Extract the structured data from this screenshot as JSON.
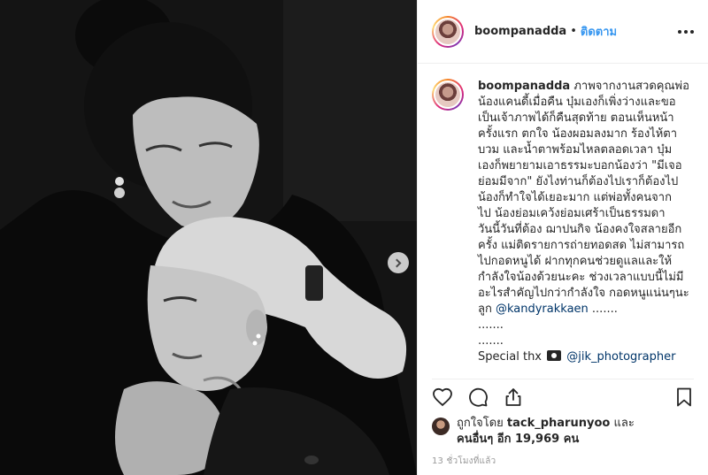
{
  "header": {
    "username": "boompanadda",
    "separator": "•",
    "follow_label": "ติดตาม",
    "more_icon": "ellipsis-icon"
  },
  "caption": {
    "username": "boompanadda",
    "lines": [
      "ภาพจากงานสวดคุณพ่อ",
      "น้องแคนดี้เมื่อคืน บุ๋มเองก็เพิ่งว่างและขอ",
      "เป็นเจ้าภาพได้ก็คืนสุดท้าย ตอนเห็นหน้า",
      "ครั้งแรก ตกใจ น้องผอมลงมาก ร้องไห้ตา",
      "บวม และน้ำตาพร้อมไหลตลอดเวลา บุ๋ม",
      "เองก็พยายามเอาธรรมะบอกน้องว่า \"มีเจอ",
      "ย่อมมีจาก\" ยังไงท่านก็ต้องไปเราก็ต้องไป",
      "น้องก็ทำใจได้เยอะมาก แต่พ่อทั้งคนจาก",
      "ไป น้องย่อมเคว้งย่อมเศร้าเป็นธรรมดา",
      "วันนี้วันที่ต้อง ฌาปนกิจ น้องคงใจสลายอีก",
      "ครั้ง แม่ติดรายการถ่ายทอดสด ไม่สามารถ",
      "ไปกอดหนูได้ ฝากทุกคนช่วยดูแลและให้",
      "กำลังใจน้องด้วยนะคะ ช่วงเวลาแบบนี้ไม่มี",
      "อะไรสำคัญไปกว่ากำลังใจ กอดหนูแน่นๆนะ"
    ],
    "last_line_prefix": "ลูก",
    "mention": "@kandyrakkaen",
    "ellipsis_1": ".......",
    "ellipsis_2": ".......",
    "ellipsis_3": ".......",
    "special_thanks": "Special thx",
    "camera_icon": "camera-icon",
    "photographer": "@jik_photographer"
  },
  "actions": {
    "like_icon": "heart-icon",
    "comment_icon": "comment-icon",
    "share_icon": "share-icon",
    "save_icon": "bookmark-icon"
  },
  "likes": {
    "prefix": "ถูกใจโดย",
    "liked_by_user": "tack_pharunyoo",
    "and": "และ",
    "others_prefix": "คนอื่นๆ อีก",
    "others_count": "19,969",
    "others_suffix": "คน"
  },
  "timestamp": "13 ชั่วโมงที่แล้ว",
  "colors": {
    "link_blue": "#3897f0",
    "mention_navy": "#003569",
    "text": "#262626",
    "muted": "#999999"
  }
}
